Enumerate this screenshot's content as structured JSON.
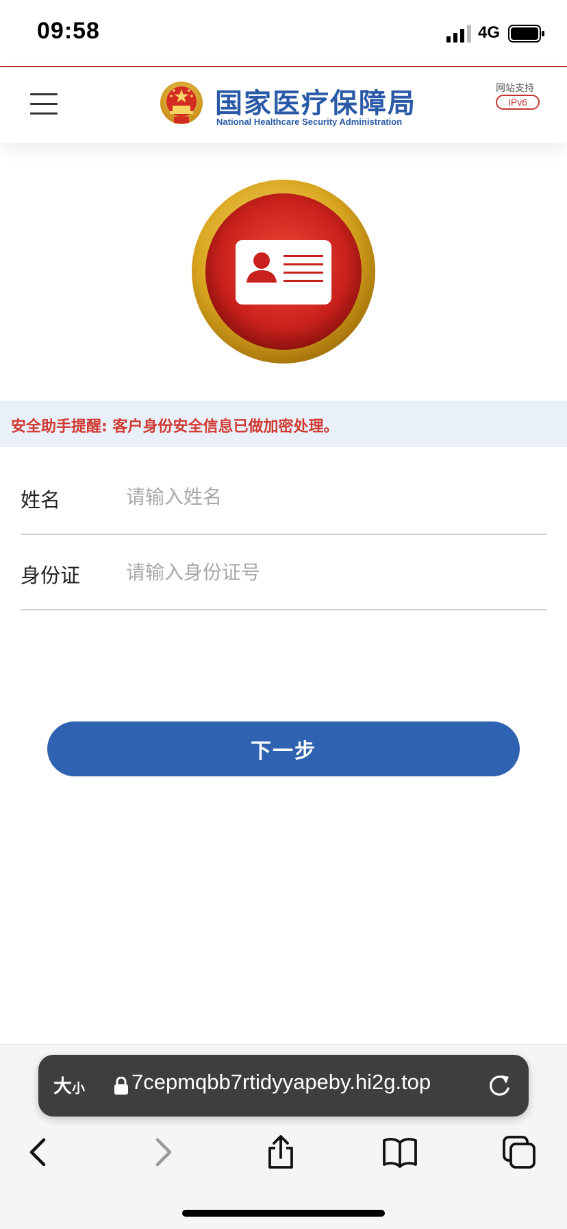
{
  "status_bar": {
    "time": "09:58",
    "network": "4G"
  },
  "header": {
    "title": "国家医疗保障局",
    "subtitle": "National Healthcare Security Administration",
    "ipv6_caption": "网站支持",
    "ipv6_badge": "IPv6"
  },
  "notice": {
    "text": "安全助手提醒: 客户身份安全信息已做加密处理。"
  },
  "form": {
    "name_label": "姓名",
    "name_placeholder": "请输入姓名",
    "id_label": "身份证",
    "id_placeholder": "请输入身份证号",
    "submit_label": "下一步"
  },
  "browser": {
    "text_size_big": "大",
    "text_size_small": "小",
    "url": "7cepmqbb7rtidyyapeby.hi2g.top"
  },
  "colors": {
    "accent_blue": "#2f62b0",
    "notice_red": "#d03a31",
    "notice_bg": "#e9f0fa",
    "emblem_gold": "#d9a520"
  },
  "icons": [
    "signal-icon",
    "battery-icon",
    "menu-icon",
    "national-emblem-icon",
    "id-card-icon",
    "lock-icon",
    "reload-icon",
    "back-icon",
    "forward-icon",
    "share-icon",
    "bookmarks-icon",
    "tabs-icon"
  ]
}
